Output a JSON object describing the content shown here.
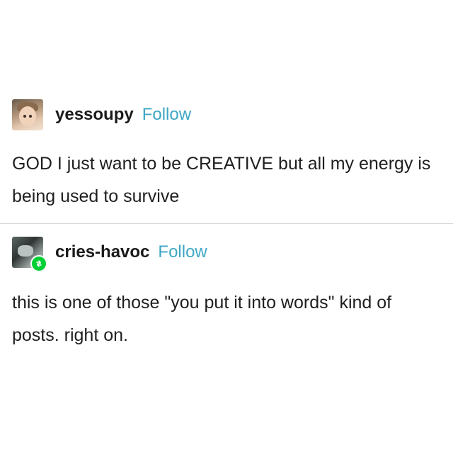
{
  "posts": [
    {
      "username": "yessoupy",
      "follow_label": "Follow",
      "text": "GOD I just want to be CREATIVE but all my energy is being used to survive"
    },
    {
      "username": "cries-havoc",
      "follow_label": "Follow",
      "text": "this is one of those \"you put it into words\" kind of posts. right on.",
      "badge_icon": "reblog-icon"
    }
  ],
  "colors": {
    "follow": "#3ea7c3",
    "reblog_badge": "#00cf35",
    "divider": "#d8d8d8"
  }
}
